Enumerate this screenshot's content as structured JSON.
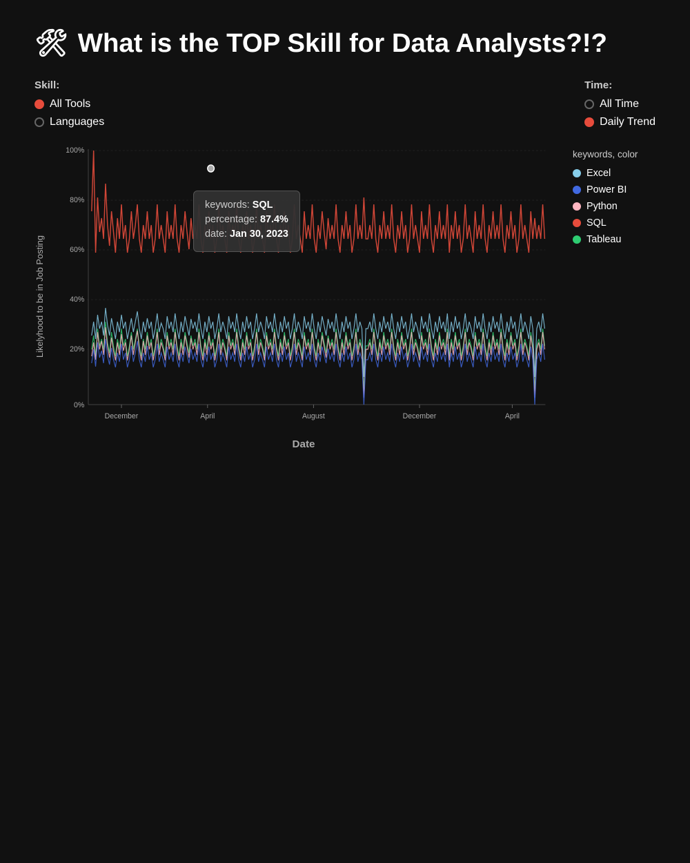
{
  "page": {
    "title": "🛠 What is the TOP Skill for Data Analysts?!?",
    "icon": "🛠️"
  },
  "controls": {
    "skill_label": "Skill:",
    "time_label": "Time:",
    "skill_options": [
      {
        "label": "All Tools",
        "active": true
      },
      {
        "label": "Languages",
        "active": false
      }
    ],
    "time_options": [
      {
        "label": "All Time",
        "active": false
      },
      {
        "label": "Daily Trend",
        "active": true
      }
    ]
  },
  "chart": {
    "y_axis_label": "Likelyhood to be in Job Posting",
    "x_axis_label": "Date",
    "x_ticks": [
      "December",
      "April",
      "August",
      "December",
      "April"
    ],
    "y_ticks": [
      "100%",
      "80%",
      "60%",
      "40%",
      "20%",
      "0%"
    ]
  },
  "legend": {
    "title": "keywords, color",
    "items": [
      {
        "label": "Excel",
        "color": "#87CEEB"
      },
      {
        "label": "Power BI",
        "color": "#4169E1"
      },
      {
        "label": "Python",
        "color": "#FFB6C1"
      },
      {
        "label": "SQL",
        "color": "#e74c3c"
      },
      {
        "label": "Tableau",
        "color": "#2ecc71"
      }
    ]
  },
  "tooltip": {
    "keyword_label": "keywords:",
    "keyword_value": "SQL",
    "percentage_label": "percentage:",
    "percentage_value": "87.4%",
    "date_label": "date:",
    "date_value": "Jan 30, 2023"
  }
}
